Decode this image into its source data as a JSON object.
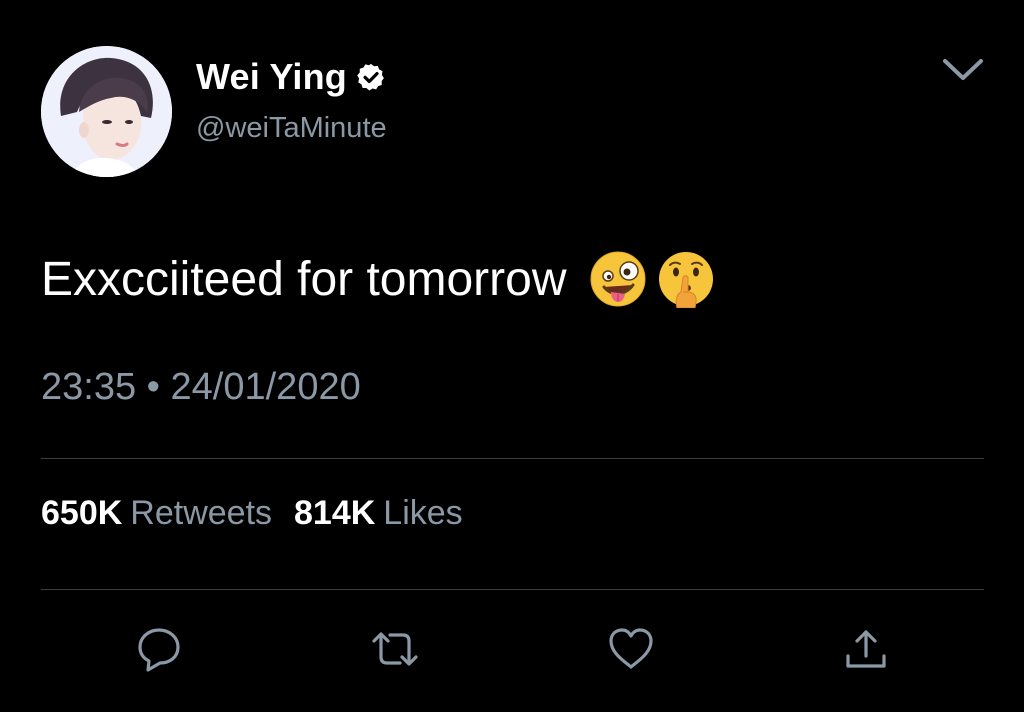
{
  "user": {
    "display_name": "Wei Ying",
    "handle": "@weiTaMinute",
    "verified": true,
    "avatar_icon": "avatar-photo"
  },
  "tweet": {
    "text": "Exxcciiteed for tomorrow",
    "emojis": [
      "zany-face",
      "shushing-face"
    ],
    "time": "23:35",
    "separator": "•",
    "date": "24/01/2020"
  },
  "stats": {
    "retweets_count": "650K",
    "retweets_label": "Retweets",
    "likes_count": "814K",
    "likes_label": "Likes"
  },
  "actions": [
    "reply-icon",
    "retweet-icon",
    "like-icon",
    "share-icon"
  ],
  "colors": {
    "background": "#000000",
    "text": "#ffffff",
    "secondary_text": "#8b98a5",
    "divider": "#3a3f44"
  }
}
